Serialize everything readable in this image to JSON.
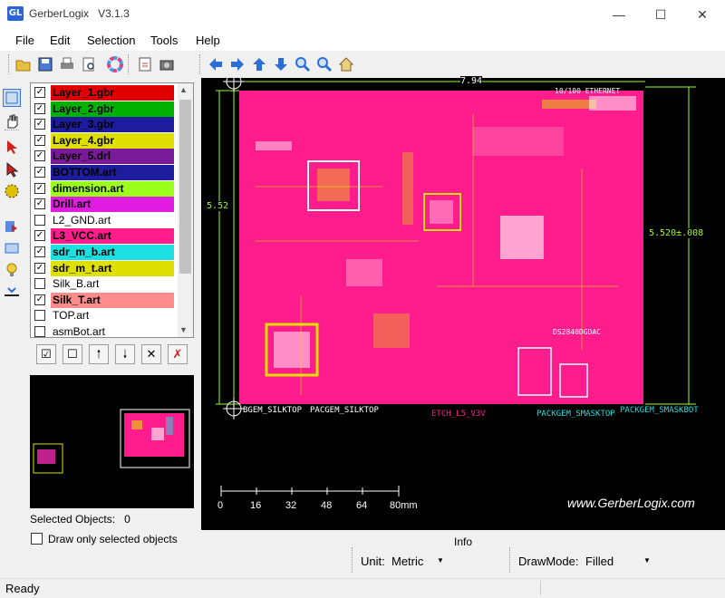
{
  "window": {
    "title": "GerberLogix",
    "version": "V3.1.3"
  },
  "menu": [
    "File",
    "Edit",
    "Selection",
    "Tools",
    "Help"
  ],
  "layers": [
    {
      "name": "Layer_1.gbr",
      "checked": true,
      "color": "#e00000"
    },
    {
      "name": "Layer_2.gbr",
      "checked": true,
      "color": "#00b000"
    },
    {
      "name": "Layer_3.gbr",
      "checked": true,
      "color": "#1c1c9c"
    },
    {
      "name": "Layer_4.gbr",
      "checked": true,
      "color": "#e0e000"
    },
    {
      "name": "Layer_5.drl",
      "checked": true,
      "color": "#7a1a9a"
    },
    {
      "name": "BOTTOM.art",
      "checked": true,
      "color": "#1c1c9c"
    },
    {
      "name": "dimension.art",
      "checked": true,
      "color": "#9cff1c"
    },
    {
      "name": "Drill.art",
      "checked": true,
      "color": "#e01ce0"
    },
    {
      "name": "L2_GND.art",
      "checked": false,
      "color": ""
    },
    {
      "name": "L3_VCC.art",
      "checked": true,
      "color": "#ff1c8c"
    },
    {
      "name": "sdr_m_b.art",
      "checked": true,
      "color": "#1ce0e0"
    },
    {
      "name": "sdr_m_t.art",
      "checked": true,
      "color": "#e0e000"
    },
    {
      "name": "Silk_B.art",
      "checked": false,
      "color": ""
    },
    {
      "name": "Silk_T.art",
      "checked": true,
      "color": "#ff8c8c"
    },
    {
      "name": "TOP.art",
      "checked": false,
      "color": ""
    },
    {
      "name": "asmBot.art",
      "checked": false,
      "color": ""
    }
  ],
  "selection": {
    "label": "Selected Objects:",
    "count": "0",
    "draw_only_label": "Draw only selected objects"
  },
  "canvas": {
    "dim_top": "7.94",
    "dim_left": "5.52",
    "dim_right": "5.520±.008",
    "labels": [
      "BGEM_SILKTOP",
      "PACGEM_SILKTOP",
      "ETCH_L5_V3V",
      "PACKGEM_SMASKTOP",
      "PACKGEM_SMASKBOT"
    ],
    "chip_label": "DS2840DGDAC",
    "eth_label": "10/100 ETHERNET",
    "scale_ticks": [
      "0",
      "16",
      "32",
      "48",
      "64",
      "80mm"
    ],
    "watermark": "www.GerberLogix.com"
  },
  "info": {
    "label": "Info",
    "unit_label": "Unit:",
    "unit_value": "Metric",
    "drawmode_label": "DrawMode:",
    "drawmode_value": "Filled"
  },
  "status": "Ready"
}
